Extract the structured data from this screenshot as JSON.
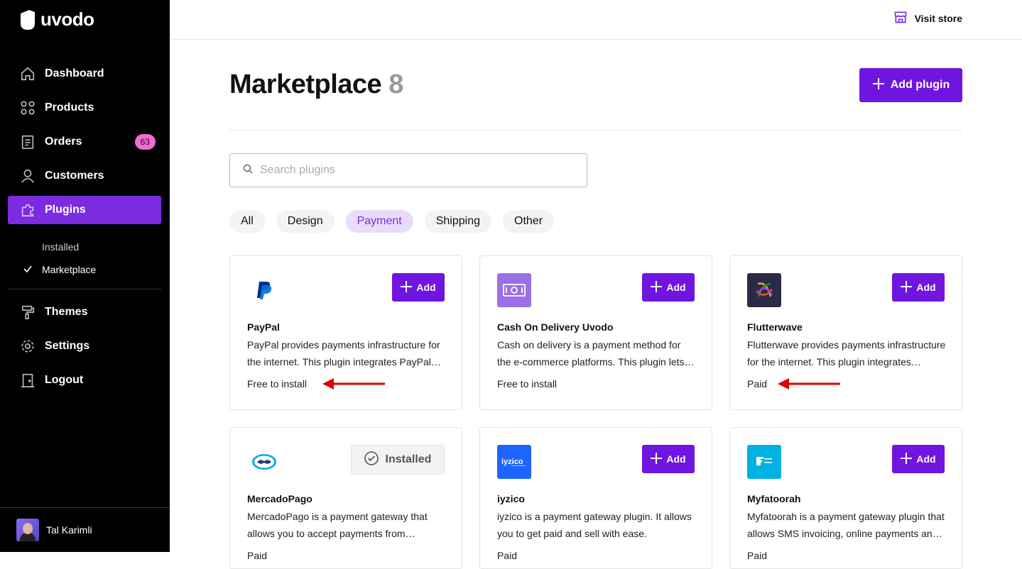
{
  "brand": {
    "name": "uvodo"
  },
  "sidebar": {
    "items": [
      {
        "label": "Dashboard",
        "icon": "home-icon"
      },
      {
        "label": "Products",
        "icon": "grid-icon"
      },
      {
        "label": "Orders",
        "icon": "clipboard-icon",
        "badge": "63"
      },
      {
        "label": "Customers",
        "icon": "user-icon"
      },
      {
        "label": "Plugins",
        "icon": "puzzle-icon",
        "active": true
      }
    ],
    "sub_items": [
      {
        "label": "Installed"
      },
      {
        "label": "Marketplace",
        "current": true
      }
    ],
    "items2": [
      {
        "label": "Themes",
        "icon": "paint-roller-icon"
      },
      {
        "label": "Settings",
        "icon": "gear-icon"
      },
      {
        "label": "Logout",
        "icon": "door-icon"
      }
    ],
    "user": {
      "name": "Tal Karimli"
    }
  },
  "topbar": {
    "visit_store": "Visit store"
  },
  "page": {
    "title": "Marketplace",
    "count": "8",
    "add_plugin": "Add plugin",
    "search_placeholder": "Search plugins",
    "filters": [
      "All",
      "Design",
      "Payment",
      "Shipping",
      "Other"
    ],
    "active_filter": "Payment"
  },
  "plugins": [
    {
      "name": "PayPal",
      "desc": "PayPal provides payments infrastructure for the internet. This plugin integrates PayPal checkout into your store.",
      "price": "Free to install",
      "action": "Add",
      "logo": "paypal-logo"
    },
    {
      "name": "Cash On Delivery Uvodo",
      "desc": "Cash on delivery is a payment method for the e-commerce platforms. This plugin lets customers pay on delivery.",
      "price": "Free to install",
      "action": "Add",
      "logo": "cash-logo"
    },
    {
      "name": "Flutterwave",
      "desc": "Flutterwave provides payments infrastructure for the internet. This plugin integrates Flutterwave.",
      "price": "Paid",
      "action": "Add",
      "logo": "flutterwave-logo"
    },
    {
      "name": "MercadoPago",
      "desc": "MercadoPago is a payment gateway that allows you to accept payments from customers.",
      "price": "Paid",
      "action": "Installed",
      "logo": "mercadopago-logo"
    },
    {
      "name": "iyzico",
      "desc": "iyzico is a payment gateway plugin. It allows you to get paid and sell with ease.",
      "price": "Paid",
      "action": "Add",
      "logo": "iyzico-logo"
    },
    {
      "name": "Myfatoorah",
      "desc": "Myfatoorah is a payment gateway plugin that allows SMS invoicing, online payments and more.",
      "price": "Paid",
      "action": "Add",
      "logo": "myfatoorah-logo"
    }
  ],
  "colors": {
    "accent": "#7014e0",
    "badge": "#f26bd3",
    "arrow": "#e00000"
  }
}
